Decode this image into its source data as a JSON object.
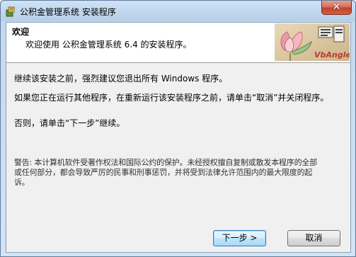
{
  "window": {
    "title": "公积金管理系统 安装程序",
    "close_label": "✕"
  },
  "header": {
    "title": "欢迎",
    "subtitle": "欢迎使用 公积金管理系统 6.4 的安装程序。",
    "logo_text": "VbAngle"
  },
  "body": {
    "paragraph1": "继续该安装之前，强烈建议您退出所有 Windows 程序。",
    "paragraph2": "如果您正在运行其他程序，在重新运行该安装程序之前，请单击“取消”并关闭程序。",
    "paragraph3": "否则，请单击“下一步”继续。",
    "warning": "警告: 本计算机软件受著作权法和国际公约的保护。未经授权擅自复制或散发本程序的全部或任何部分，都会导致严厉的民事和刑事惩罚，并将受到法律允许范围内的最大限度的起诉。"
  },
  "buttons": {
    "next_label": "下一步 >",
    "cancel_label": "取消"
  },
  "colors": {
    "titlebar": "#c3d9ee",
    "close": "#c0422c",
    "dialog_bg": "#f0f0f0",
    "header_bg": "#ffffff",
    "logo_text": "#c0392b"
  }
}
